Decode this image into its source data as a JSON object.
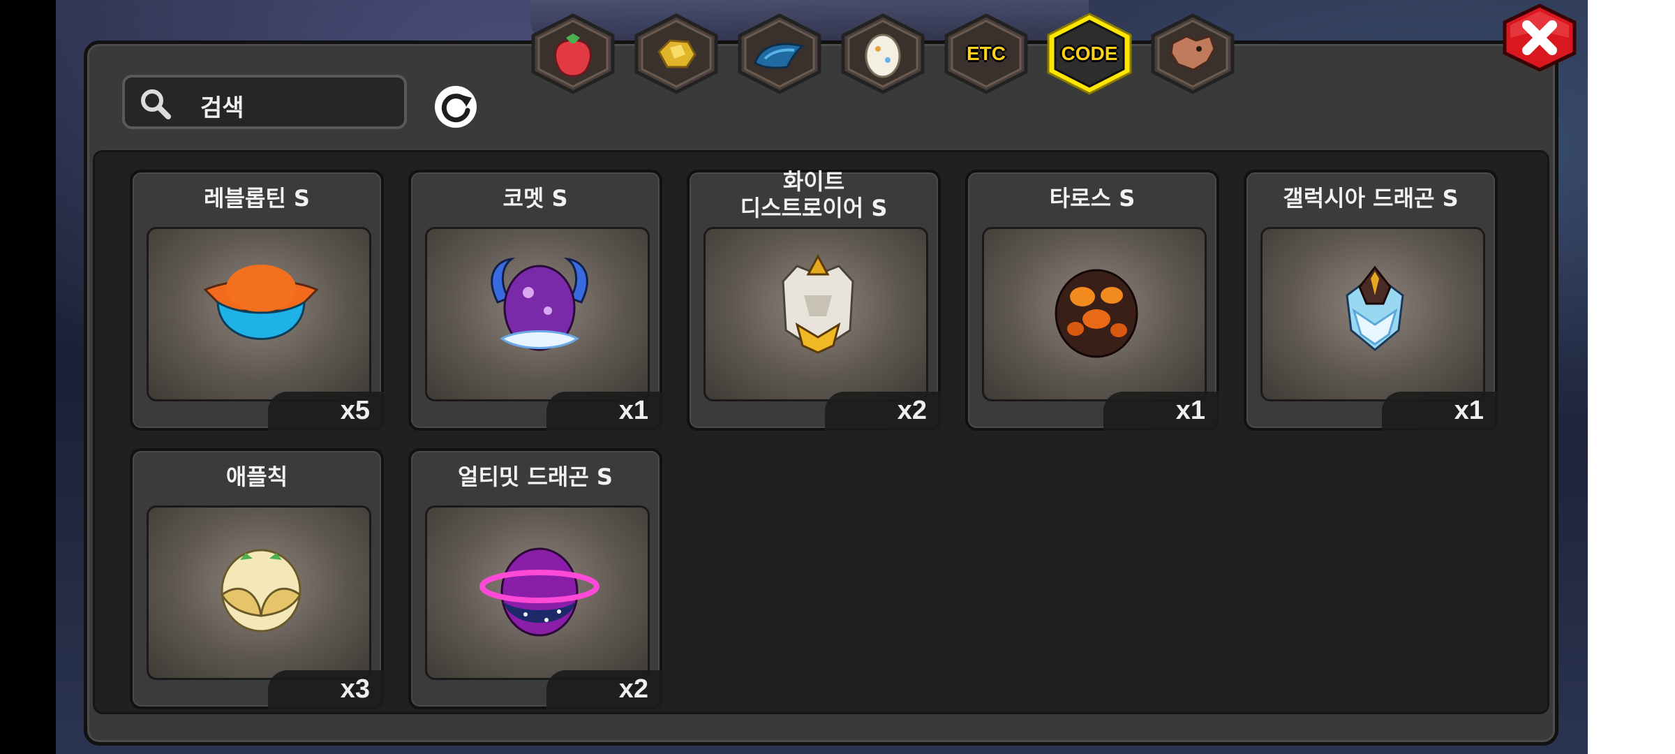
{
  "search": {
    "placeholder": "검색"
  },
  "tabs": [
    {
      "id": "fruit",
      "label": "",
      "icon": "strawberry-icon",
      "active": false
    },
    {
      "id": "gold",
      "label": "",
      "icon": "gold-nugget-icon",
      "active": false
    },
    {
      "id": "scale",
      "label": "",
      "icon": "dragon-scale-icon",
      "active": false
    },
    {
      "id": "egg",
      "label": "",
      "icon": "egg-icon",
      "active": false
    },
    {
      "id": "etc",
      "label": "ETC",
      "icon": "",
      "active": false
    },
    {
      "id": "code",
      "label": "CODE",
      "icon": "",
      "active": true
    },
    {
      "id": "beast",
      "label": "",
      "icon": "dragon-head-icon",
      "active": false
    }
  ],
  "items": [
    {
      "name": "레블롭틴 S",
      "qty": "x5",
      "icon": "orange-blue-egg-icon"
    },
    {
      "name": "코멧 S",
      "qty": "x1",
      "icon": "purple-horned-egg-icon"
    },
    {
      "name": "화이트\n디스트로이어 S",
      "qty": "x2",
      "icon": "white-armored-egg-icon"
    },
    {
      "name": "타로스 S",
      "qty": "x1",
      "icon": "lava-egg-icon"
    },
    {
      "name": "갤럭시아 드래곤 S",
      "qty": "x1",
      "icon": "galaxy-crystal-egg-icon"
    },
    {
      "name": "애플칙",
      "qty": "x3",
      "icon": "winged-cream-egg-icon"
    },
    {
      "name": "얼티밋 드래곤 S",
      "qty": "x2",
      "icon": "ringed-purple-egg-icon"
    }
  ],
  "colors": {
    "active_tab": "#ffe600",
    "accent_text": "#ffd21a",
    "close_red": "#d8171f"
  }
}
